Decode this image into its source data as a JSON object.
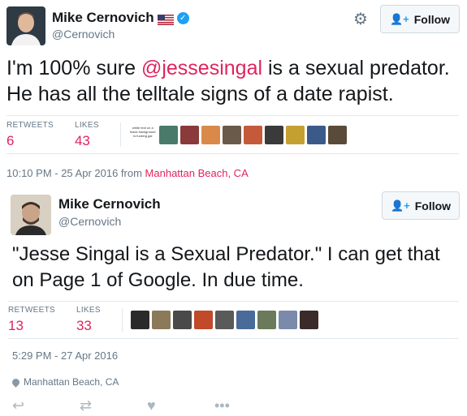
{
  "tweet1": {
    "name": "Mike Cernovich",
    "handle": "@Cernovich",
    "follow_label": "Follow",
    "text_before": "I'm 100% sure ",
    "mention": "@jessesingal",
    "text_after": " is a sexual predator. He has all the telltale signs of a date rapist.",
    "retweets_label": "RETWEETS",
    "retweets": "6",
    "likes_label": "LIKES",
    "likes": "43",
    "liker_text": "white text on a black background is fucking gai",
    "timestamp": "10:10 PM - 25 Apr 2016 from ",
    "place": "Manhattan Beach, CA",
    "icons": [
      "flag-us-icon",
      "verified-icon",
      "gear-icon",
      "add-user-icon"
    ]
  },
  "tweet2": {
    "name": "Mike Cernovich",
    "handle": "@Cernovich",
    "follow_label": "Follow",
    "text": "\"Jesse Singal is a Sexual Predator.\" I can get that on Page 1 of Google. In due time.",
    "retweets_label": "RETWEETS",
    "retweets": "13",
    "likes_label": "LIKES",
    "likes": "33",
    "timestamp": "5:29 PM - 27 Apr 2016",
    "location": "Manhattan Beach, CA",
    "icons": [
      "pin-icon",
      "reply-icon",
      "retweet-icon",
      "heart-icon",
      "more-icon"
    ]
  },
  "colors": {
    "accent_pink": "#e0245e",
    "twitter_blue": "#1da1f2",
    "muted": "#657786",
    "border": "#e1e8ed"
  }
}
